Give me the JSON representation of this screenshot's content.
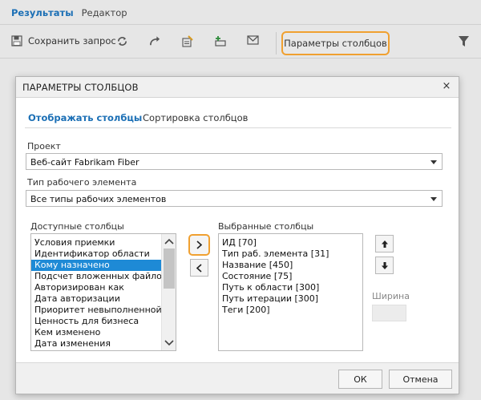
{
  "top_tabs": [
    {
      "label": "Результаты",
      "active": true
    },
    {
      "label": "Редактор",
      "active": false
    }
  ],
  "toolbar": {
    "save_label": "Сохранить запрос",
    "column_options_label": "Параметры столбцов",
    "icons": [
      "save-icon",
      "refresh-icon",
      "redo-icon",
      "edit-selected-icon",
      "new-linked-item-icon",
      "email-icon",
      "filter-icon"
    ]
  },
  "dialog": {
    "title": "ПАРАМЕТРЫ СТОЛБЦОВ",
    "close_glyph": "×",
    "tabs": [
      {
        "label": "Отображать столбцы",
        "active": true
      },
      {
        "label": "Сортировка столбцов",
        "active": false
      }
    ],
    "project": {
      "label": "Проект",
      "value": "Веб-сайт Fabrikam Fiber"
    },
    "work_item_type": {
      "label": "Тип рабочего элемента",
      "value": "Все типы рабочих элементов"
    },
    "available_columns": {
      "label": "Доступные столбцы",
      "items": [
        "Условия приемки",
        "Идентификатор области",
        "Кому назначено",
        "Подсчет вложенных файлов",
        "Авторизирован как",
        "Дата авторизации",
        "Приоритет невыполненной р...",
        "Ценность для бизнеса",
        "Кем изменено",
        "Дата изменения"
      ],
      "selected_index": 2
    },
    "selected_columns": {
      "label": "Выбранные столбцы",
      "items": [
        "ИД [70]",
        "Тип раб. элемента [31]",
        "Название [450]",
        "Состояние [75]",
        "Путь к области [300]",
        "Путь итерации [300]",
        "Теги [200]"
      ]
    },
    "width_label": "Ширина",
    "ok_label": "ОК",
    "cancel_label": "Отмена"
  },
  "colors": {
    "accent": "#1b6fb5",
    "highlight_outline": "#f0a030",
    "selection": "#1e8ad6"
  }
}
